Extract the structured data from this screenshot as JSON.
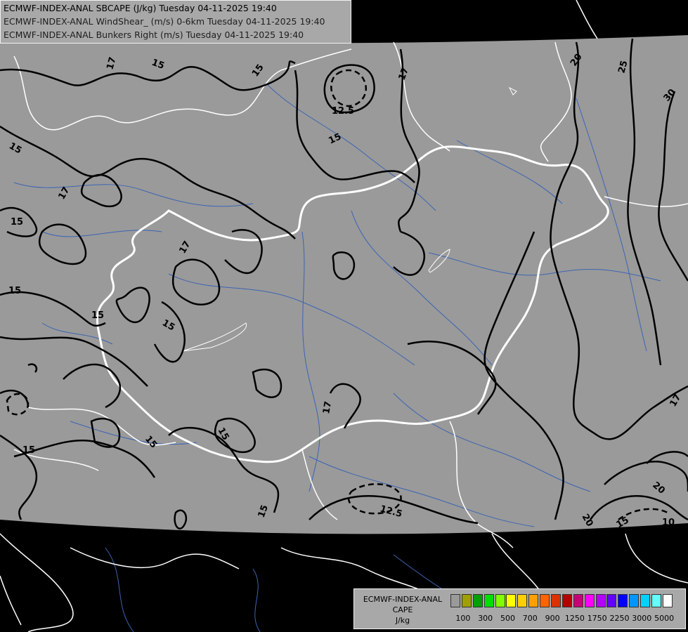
{
  "header": {
    "line1": "ECMWF-INDEX-ANAL SBCAPE (J/kg) Tuesday 04-11-2025 19:40",
    "line2": "ECMWF-INDEX-ANAL WindShear_ (m/s) 0-6km Tuesday 04-11-2025 19:40",
    "line3": "ECMWF-INDEX-ANAL Bunkers Right (m/s) Tuesday 04-11-2025 19:40"
  },
  "legend": {
    "title_line1": "ECMWF-INDEX-ANAL",
    "title_line2": "CAPE",
    "title_line3": "J/kg",
    "swatches": [
      "#9a9a9a",
      "#a0a000",
      "#00a000",
      "#00e000",
      "#80ff00",
      "#ffff00",
      "#ffd000",
      "#ffa000",
      "#ff6400",
      "#dc3200",
      "#b40000",
      "#c80078",
      "#ff00ff",
      "#b400ff",
      "#6400ff",
      "#0000ff",
      "#0096ff",
      "#00d2ff",
      "#64ffff",
      "#ffffff"
    ],
    "labels": [
      {
        "text": "100",
        "idx": 1
      },
      {
        "text": "300",
        "idx": 3
      },
      {
        "text": "500",
        "idx": 5
      },
      {
        "text": "700",
        "idx": 7
      },
      {
        "text": "900",
        "idx": 9
      },
      {
        "text": "1250",
        "idx": 11
      },
      {
        "text": "1750",
        "idx": 13
      },
      {
        "text": "2250",
        "idx": 15
      },
      {
        "text": "3000",
        "idx": 17
      },
      {
        "text": "5000",
        "idx": 19
      }
    ]
  },
  "contour_labels": [
    "15",
    "17",
    "12.5",
    "20",
    "25",
    "30",
    "10"
  ],
  "colors": {
    "background": "#000000",
    "domain_fill": "#9a9a9a",
    "contour": "#000000",
    "borders": "#ffffff",
    "rivers": "#3c64b4"
  }
}
